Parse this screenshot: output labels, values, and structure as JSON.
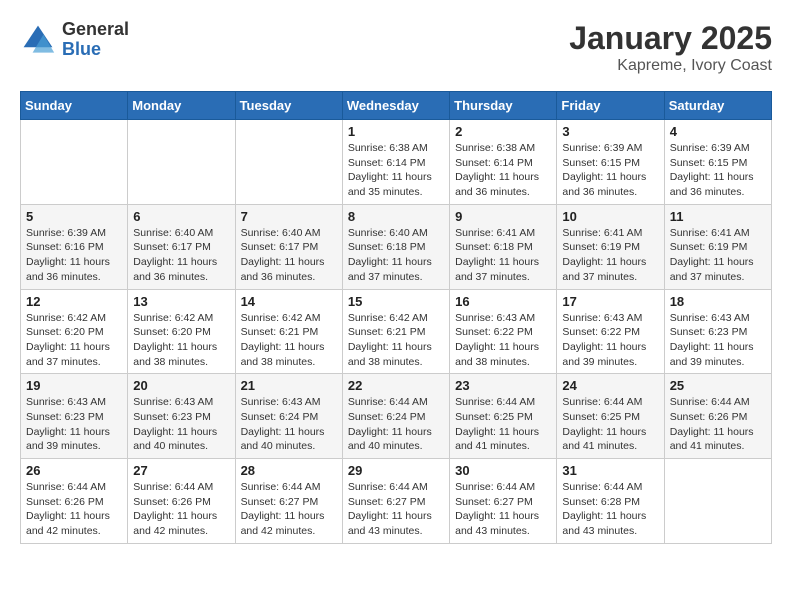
{
  "header": {
    "logo": {
      "general": "General",
      "blue": "Blue"
    },
    "title": "January 2025",
    "location": "Kapreme, Ivory Coast"
  },
  "weekdays": [
    "Sunday",
    "Monday",
    "Tuesday",
    "Wednesday",
    "Thursday",
    "Friday",
    "Saturday"
  ],
  "weeks": [
    [
      {
        "day": "",
        "info": ""
      },
      {
        "day": "",
        "info": ""
      },
      {
        "day": "",
        "info": ""
      },
      {
        "day": "1",
        "info": "Sunrise: 6:38 AM\nSunset: 6:14 PM\nDaylight: 11 hours\nand 35 minutes."
      },
      {
        "day": "2",
        "info": "Sunrise: 6:38 AM\nSunset: 6:14 PM\nDaylight: 11 hours\nand 36 minutes."
      },
      {
        "day": "3",
        "info": "Sunrise: 6:39 AM\nSunset: 6:15 PM\nDaylight: 11 hours\nand 36 minutes."
      },
      {
        "day": "4",
        "info": "Sunrise: 6:39 AM\nSunset: 6:15 PM\nDaylight: 11 hours\nand 36 minutes."
      }
    ],
    [
      {
        "day": "5",
        "info": "Sunrise: 6:39 AM\nSunset: 6:16 PM\nDaylight: 11 hours\nand 36 minutes."
      },
      {
        "day": "6",
        "info": "Sunrise: 6:40 AM\nSunset: 6:17 PM\nDaylight: 11 hours\nand 36 minutes."
      },
      {
        "day": "7",
        "info": "Sunrise: 6:40 AM\nSunset: 6:17 PM\nDaylight: 11 hours\nand 36 minutes."
      },
      {
        "day": "8",
        "info": "Sunrise: 6:40 AM\nSunset: 6:18 PM\nDaylight: 11 hours\nand 37 minutes."
      },
      {
        "day": "9",
        "info": "Sunrise: 6:41 AM\nSunset: 6:18 PM\nDaylight: 11 hours\nand 37 minutes."
      },
      {
        "day": "10",
        "info": "Sunrise: 6:41 AM\nSunset: 6:19 PM\nDaylight: 11 hours\nand 37 minutes."
      },
      {
        "day": "11",
        "info": "Sunrise: 6:41 AM\nSunset: 6:19 PM\nDaylight: 11 hours\nand 37 minutes."
      }
    ],
    [
      {
        "day": "12",
        "info": "Sunrise: 6:42 AM\nSunset: 6:20 PM\nDaylight: 11 hours\nand 37 minutes."
      },
      {
        "day": "13",
        "info": "Sunrise: 6:42 AM\nSunset: 6:20 PM\nDaylight: 11 hours\nand 38 minutes."
      },
      {
        "day": "14",
        "info": "Sunrise: 6:42 AM\nSunset: 6:21 PM\nDaylight: 11 hours\nand 38 minutes."
      },
      {
        "day": "15",
        "info": "Sunrise: 6:42 AM\nSunset: 6:21 PM\nDaylight: 11 hours\nand 38 minutes."
      },
      {
        "day": "16",
        "info": "Sunrise: 6:43 AM\nSunset: 6:22 PM\nDaylight: 11 hours\nand 38 minutes."
      },
      {
        "day": "17",
        "info": "Sunrise: 6:43 AM\nSunset: 6:22 PM\nDaylight: 11 hours\nand 39 minutes."
      },
      {
        "day": "18",
        "info": "Sunrise: 6:43 AM\nSunset: 6:23 PM\nDaylight: 11 hours\nand 39 minutes."
      }
    ],
    [
      {
        "day": "19",
        "info": "Sunrise: 6:43 AM\nSunset: 6:23 PM\nDaylight: 11 hours\nand 39 minutes."
      },
      {
        "day": "20",
        "info": "Sunrise: 6:43 AM\nSunset: 6:23 PM\nDaylight: 11 hours\nand 40 minutes."
      },
      {
        "day": "21",
        "info": "Sunrise: 6:43 AM\nSunset: 6:24 PM\nDaylight: 11 hours\nand 40 minutes."
      },
      {
        "day": "22",
        "info": "Sunrise: 6:44 AM\nSunset: 6:24 PM\nDaylight: 11 hours\nand 40 minutes."
      },
      {
        "day": "23",
        "info": "Sunrise: 6:44 AM\nSunset: 6:25 PM\nDaylight: 11 hours\nand 41 minutes."
      },
      {
        "day": "24",
        "info": "Sunrise: 6:44 AM\nSunset: 6:25 PM\nDaylight: 11 hours\nand 41 minutes."
      },
      {
        "day": "25",
        "info": "Sunrise: 6:44 AM\nSunset: 6:26 PM\nDaylight: 11 hours\nand 41 minutes."
      }
    ],
    [
      {
        "day": "26",
        "info": "Sunrise: 6:44 AM\nSunset: 6:26 PM\nDaylight: 11 hours\nand 42 minutes."
      },
      {
        "day": "27",
        "info": "Sunrise: 6:44 AM\nSunset: 6:26 PM\nDaylight: 11 hours\nand 42 minutes."
      },
      {
        "day": "28",
        "info": "Sunrise: 6:44 AM\nSunset: 6:27 PM\nDaylight: 11 hours\nand 42 minutes."
      },
      {
        "day": "29",
        "info": "Sunrise: 6:44 AM\nSunset: 6:27 PM\nDaylight: 11 hours\nand 43 minutes."
      },
      {
        "day": "30",
        "info": "Sunrise: 6:44 AM\nSunset: 6:27 PM\nDaylight: 11 hours\nand 43 minutes."
      },
      {
        "day": "31",
        "info": "Sunrise: 6:44 AM\nSunset: 6:28 PM\nDaylight: 11 hours\nand 43 minutes."
      },
      {
        "day": "",
        "info": ""
      }
    ]
  ]
}
